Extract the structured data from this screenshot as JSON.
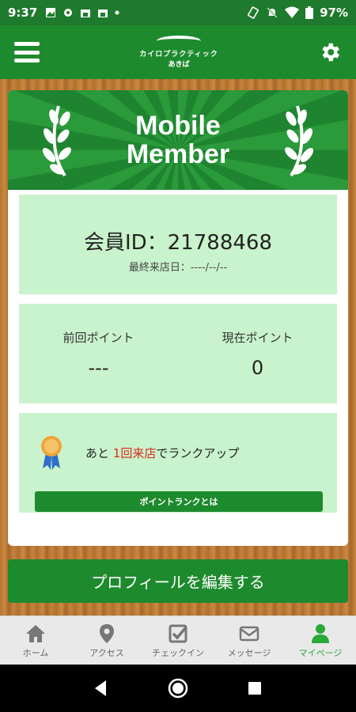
{
  "status_bar": {
    "time": "9:37",
    "battery": "97%",
    "icons": [
      "image-icon",
      "settings-icon",
      "store-icon",
      "store-icon",
      "dot-icon",
      "rotate-icon",
      "mute-icon",
      "wifi-icon",
      "battery-icon"
    ]
  },
  "header": {
    "logo_line1": "カイロプラクティック",
    "logo_line2": "あきば"
  },
  "card": {
    "banner_title": "Mobile\nMember",
    "member_id": "会員ID：21788468",
    "last_visit": "最終来店日：----/--/--",
    "prev_points_label": "前回ポイント",
    "prev_points_value": "---",
    "current_points_label": "現在ポイント",
    "current_points_value": "0",
    "rank_prefix": "あと ",
    "rank_highlight": "1回来店",
    "rank_suffix": "でランクアップ",
    "rank_button": "ポイントランクとは"
  },
  "profile_button": "プロフィールを編集する",
  "bottom_nav": [
    {
      "label": "ホーム",
      "icon": "home-icon"
    },
    {
      "label": "アクセス",
      "icon": "map-pin-icon"
    },
    {
      "label": "チェックイン",
      "icon": "checkin-icon"
    },
    {
      "label": "メッセージ",
      "icon": "mail-icon"
    },
    {
      "label": "マイページ",
      "icon": "person-icon",
      "active": true
    }
  ],
  "colors": {
    "primary": "#1e8a2e",
    "panel": "#c9f3cc",
    "highlight": "#e0281e",
    "active_tab": "#2aa83a"
  }
}
